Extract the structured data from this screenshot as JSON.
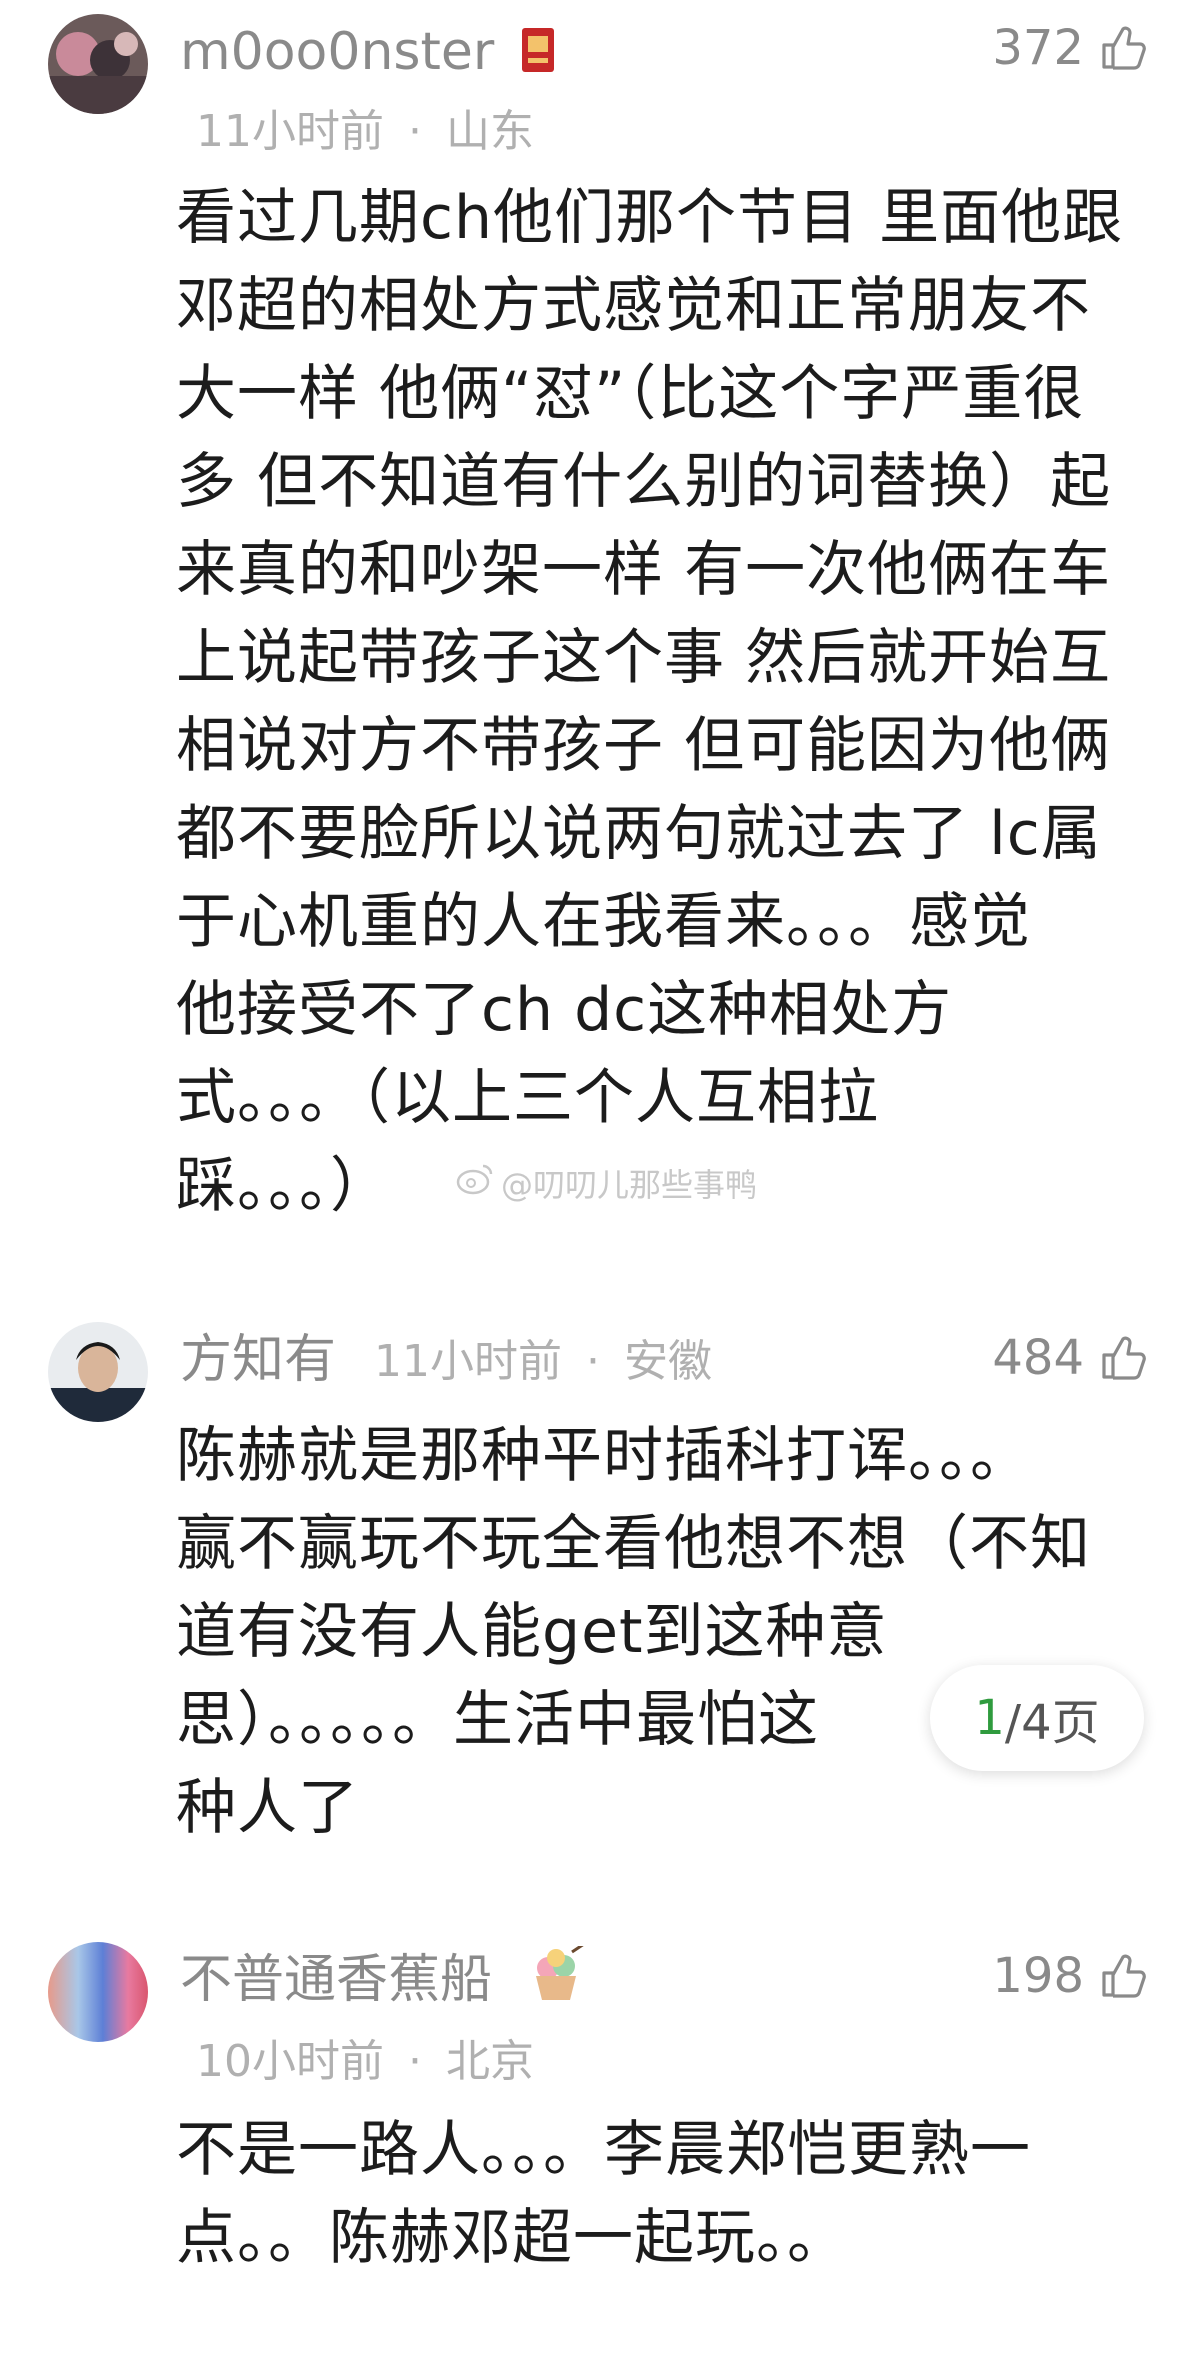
{
  "comments": [
    {
      "username": "m0oo0nster",
      "time": "11小时前",
      "location": "山东",
      "likes": "372",
      "lines": [
        "看过几期ch他们那个节目 里面他跟",
        "邓超的相处方式感觉和正常朋友不",
        "大一样 他俩“怼”（比这个字严重很",
        "多 但不知道有什么别的词替换）起",
        "来真的和吵架一样 有一次他俩在车",
        "上说起带孩子这个事 然后就开始互",
        "相说对方不带孩子 但可能因为他俩",
        "都不要脸所以说两句就过去了 lc属",
        "于心机重的人在我看来。。。感觉",
        "他接受不了ch dc这种相处方",
        "式。。。（以上三个人互相拉",
        "踩。。。）"
      ]
    },
    {
      "username": "方知有",
      "time": "11小时前",
      "location": "安徽",
      "likes": "484",
      "lines": [
        "陈赫就是那种平时插科打诨。。。",
        "赢不赢玩不玩全看他想不想（不知",
        "道有没有人能get到这种意",
        "思）。。。。。生活中最怕这",
        "种人了"
      ]
    },
    {
      "username": "不普通香蕉船",
      "time": "10小时前",
      "location": "北京",
      "likes": "198",
      "lines": [
        "不是一路人。。。李晨郑恺更熟一",
        "点。。陈赫邓超一起玩。。"
      ]
    }
  ],
  "meta_separator": "·",
  "watermark": "@叨叨儿那些事鸭",
  "pager": {
    "current": "1",
    "total_suffix": "/4页"
  },
  "icons": {
    "like": "thumbs-up-icon",
    "badge1": "red-badge-icon",
    "badge3": "ice-cream-icon",
    "watermark": "weibo-icon"
  },
  "colors": {
    "pager_current": "#2f9b3e"
  }
}
